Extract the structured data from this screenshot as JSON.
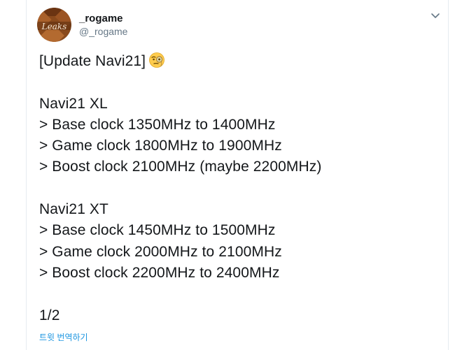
{
  "tweet": {
    "author": {
      "display_name": "_rogame",
      "handle": "@_rogame",
      "avatar_text": "Leaks"
    },
    "menu_icon": "chevron-down-icon",
    "lines": {
      "title": "[Update Navi21]",
      "xl_title": "Navi21 XL",
      "xl_base": "> Base clock 1350MHz to 1400MHz",
      "xl_game": "> Game clock 1800MHz to 1900MHz",
      "xl_boost": "> Boost clock 2100MHz (maybe 2200MHz)",
      "xt_title": "Navi21 XT",
      "xt_base": "> Base clock 1450MHz to 1500MHz",
      "xt_game": "> Game clock 2000MHz to 2100MHz",
      "xt_boost": "> Boost clock 2200MHz to 2400MHz",
      "page": "1/2"
    },
    "emoji": "face-with-monocle-icon",
    "translate_label": "트윗 번역하기"
  },
  "colors": {
    "link": "#1b95e0",
    "secondary_text": "#657786",
    "border": "#e6ecf0"
  }
}
